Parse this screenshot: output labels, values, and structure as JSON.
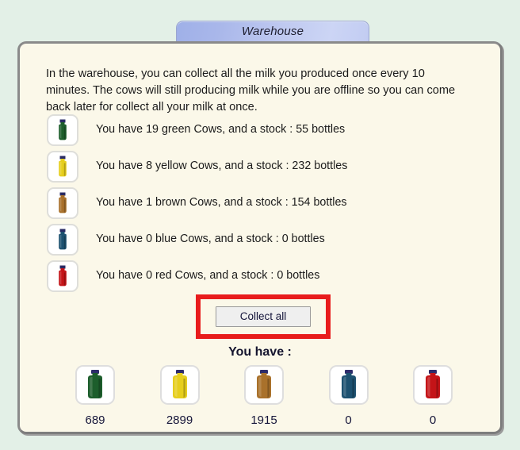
{
  "tab": {
    "label": "Warehouse"
  },
  "intro": {
    "text": "In the warehouse, you can collect all the milk you produced once every 10 minutes. The cows will still producing milk while you are offline so you can come back later for collect all your milk at once."
  },
  "stock_rows": [
    {
      "icon": "milk-bottle-green-icon",
      "color": "#1d5e2c",
      "cap": "#282a63",
      "label": "You have 19 green Cows, and a stock : 55 bottles"
    },
    {
      "icon": "milk-bottle-yellow-icon",
      "color": "#e6ce1d",
      "cap": "#282a63",
      "label": "You have 8 yellow Cows, and a stock : 232 bottles"
    },
    {
      "icon": "milk-bottle-brown-icon",
      "color": "#a9712b",
      "cap": "#282a63",
      "label": "You have 1 brown Cows, and a stock : 154 bottles"
    },
    {
      "icon": "milk-bottle-blue-icon",
      "color": "#1d5170",
      "cap": "#282a63",
      "label": "You have 0 blue Cows, and a stock : 0 bottles"
    },
    {
      "icon": "milk-bottle-red-icon",
      "color": "#c41418",
      "cap": "#282a63",
      "label": "You have 0 red Cows, and a stock : 0 bottles"
    }
  ],
  "collect": {
    "label": "Collect all",
    "highlight_color": "#e81c1c"
  },
  "totals_heading": "You have :",
  "totals": [
    {
      "icon": "milk-jar-green-icon",
      "color": "#1d5e2c",
      "cap": "#2e2d6b",
      "count": "689"
    },
    {
      "icon": "milk-jar-yellow-icon",
      "color": "#e6ce1d",
      "cap": "#2e2d6b",
      "count": "2899"
    },
    {
      "icon": "milk-jar-brown-icon",
      "color": "#a9712b",
      "cap": "#2e2d6b",
      "count": "1915"
    },
    {
      "icon": "milk-jar-blue-icon",
      "color": "#1d5170",
      "cap": "#2e2d6b",
      "count": "0"
    },
    {
      "icon": "milk-jar-red-icon",
      "color": "#c41418",
      "cap": "#2e2d6b",
      "count": "0"
    }
  ],
  "theme": {
    "page_background": "#e3f0e7",
    "panel_background": "#fbf8e9",
    "panel_border": "#8a8a8a",
    "tab_gradient_from": "#9fb0e8",
    "tab_gradient_to": "#ccd5f5"
  }
}
